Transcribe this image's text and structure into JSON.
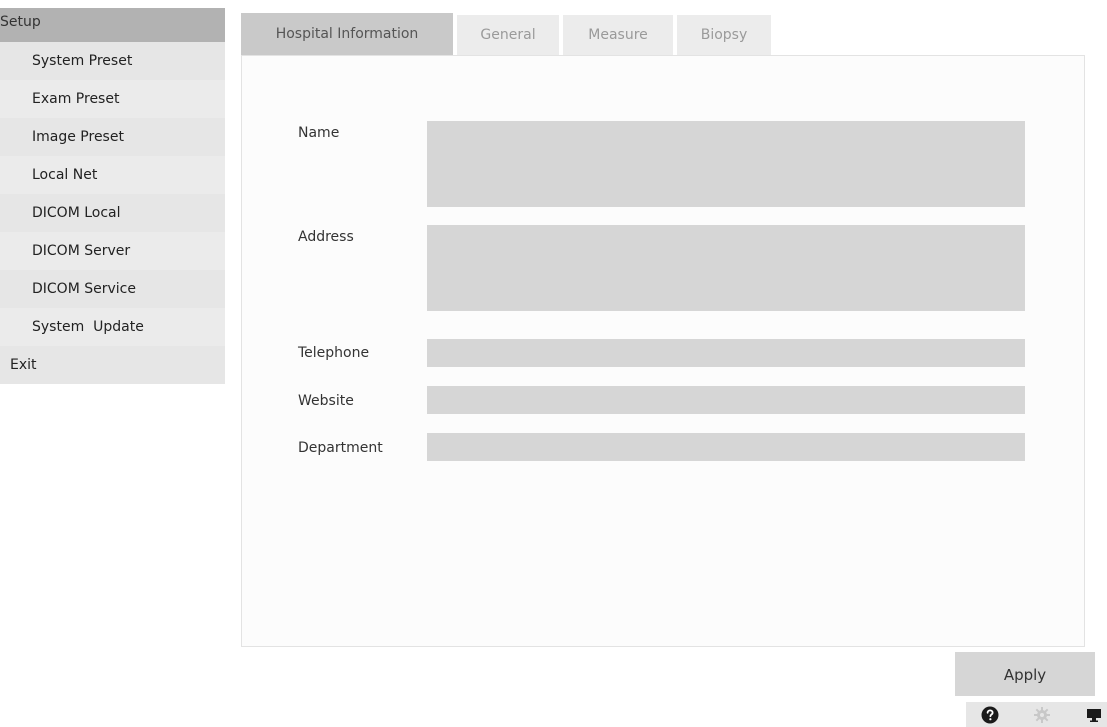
{
  "sidebar": {
    "header": "Setup",
    "items": [
      {
        "label": "System Preset"
      },
      {
        "label": "Exam Preset"
      },
      {
        "label": "Image Preset"
      },
      {
        "label": "Local Net"
      },
      {
        "label": "DICOM Local"
      },
      {
        "label": "DICOM Server"
      },
      {
        "label": "DICOM Service"
      },
      {
        "label": "System  Update"
      },
      {
        "label": "Exit"
      }
    ]
  },
  "tabs": [
    {
      "label": "Hospital Information",
      "active": true
    },
    {
      "label": "General",
      "active": false
    },
    {
      "label": "Measure",
      "active": false
    },
    {
      "label": "Biopsy",
      "active": false
    }
  ],
  "form": {
    "name": {
      "label": "Name",
      "value": ""
    },
    "address": {
      "label": "Address",
      "value": ""
    },
    "telephone": {
      "label": "Telephone",
      "value": ""
    },
    "website": {
      "label": "Website",
      "value": ""
    },
    "department": {
      "label": "Department",
      "value": ""
    }
  },
  "actions": {
    "apply_label": "Apply"
  },
  "statusbar": {
    "icons": [
      "help-icon",
      "gear-icon",
      "monitor-icon"
    ]
  },
  "colors": {
    "sidebar_header_bg": "#b2b2b2",
    "tab_active_bg": "#c9c9c9",
    "field_bg": "#d6d6d6"
  }
}
